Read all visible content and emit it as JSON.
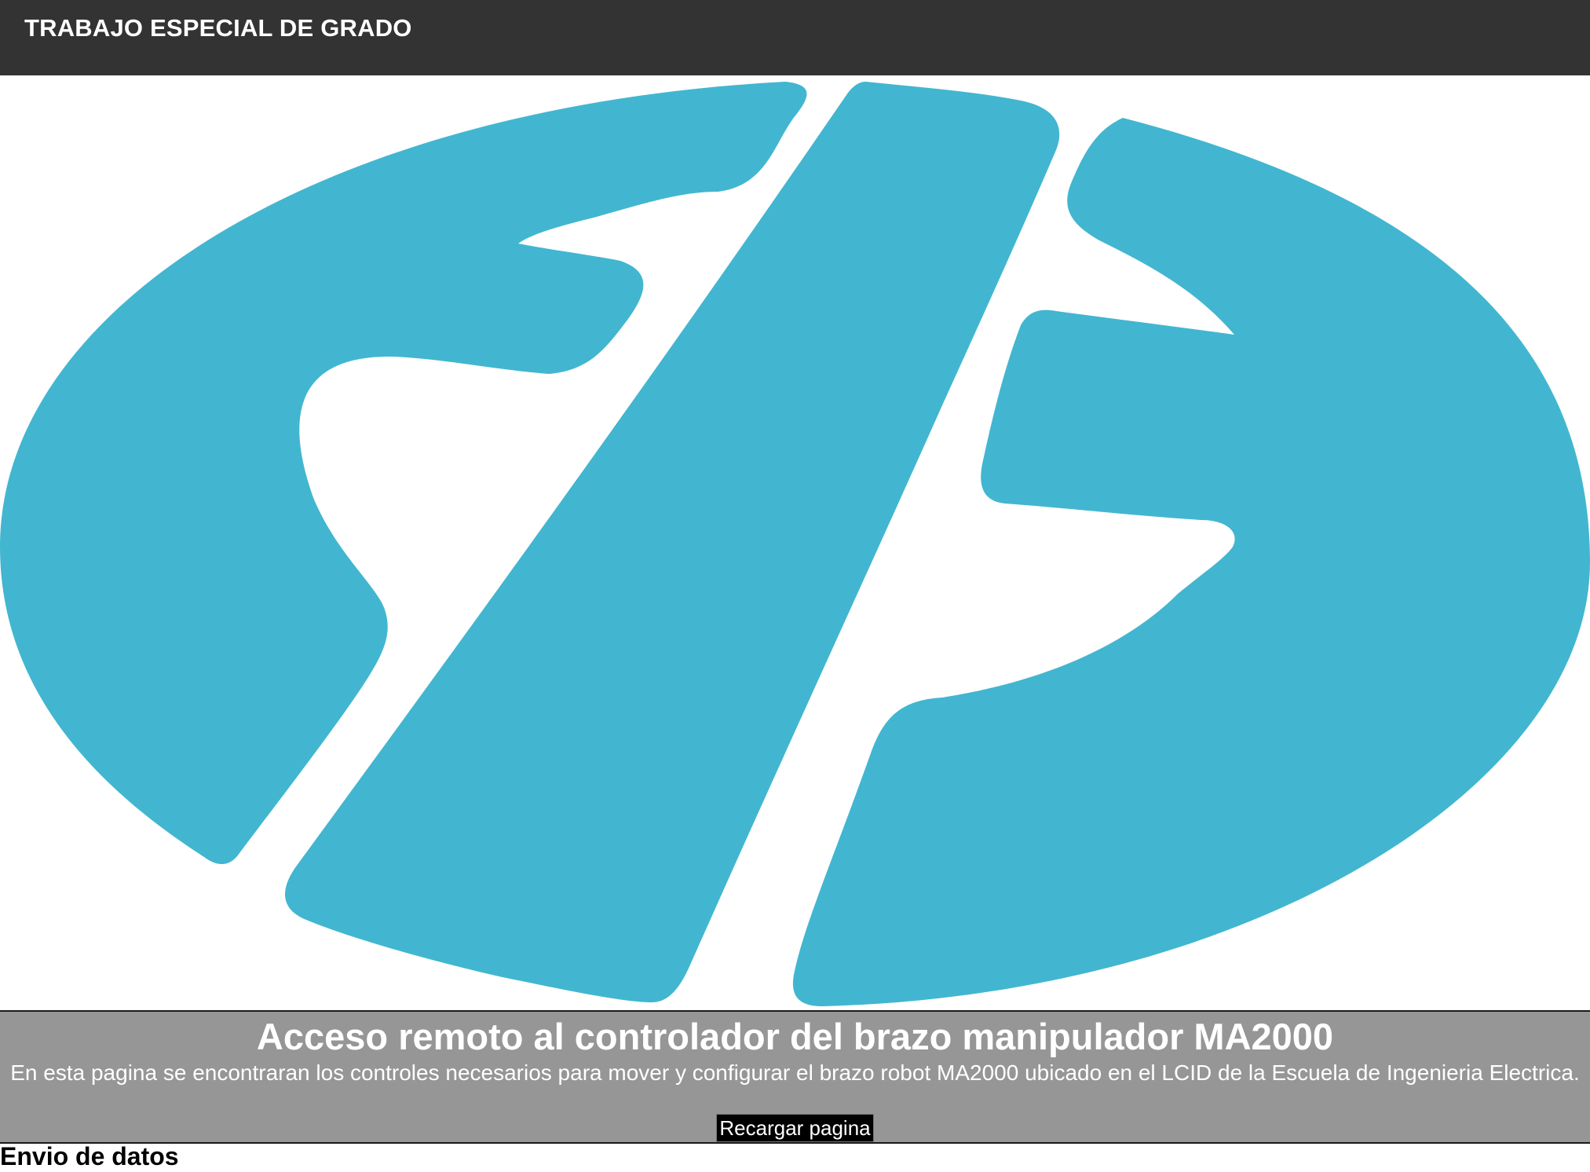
{
  "header": {
    "title": "TRABAJO ESPECIAL DE GRADO"
  },
  "logo": {
    "name": "escuela-logo",
    "color": "#42B6D0"
  },
  "banner": {
    "title": "Acceso remoto al controlador del brazo manipulador MA2000",
    "description": "En esta pagina se encontraran los controles necesarios para mover y configurar el brazo robot MA2000 ubicado en el LCID de la Escuela de Ingenieria Electrica.",
    "reload_label": "Recargar pagina",
    "background": "#969696"
  },
  "section": {
    "heading": "Envio de datos"
  }
}
